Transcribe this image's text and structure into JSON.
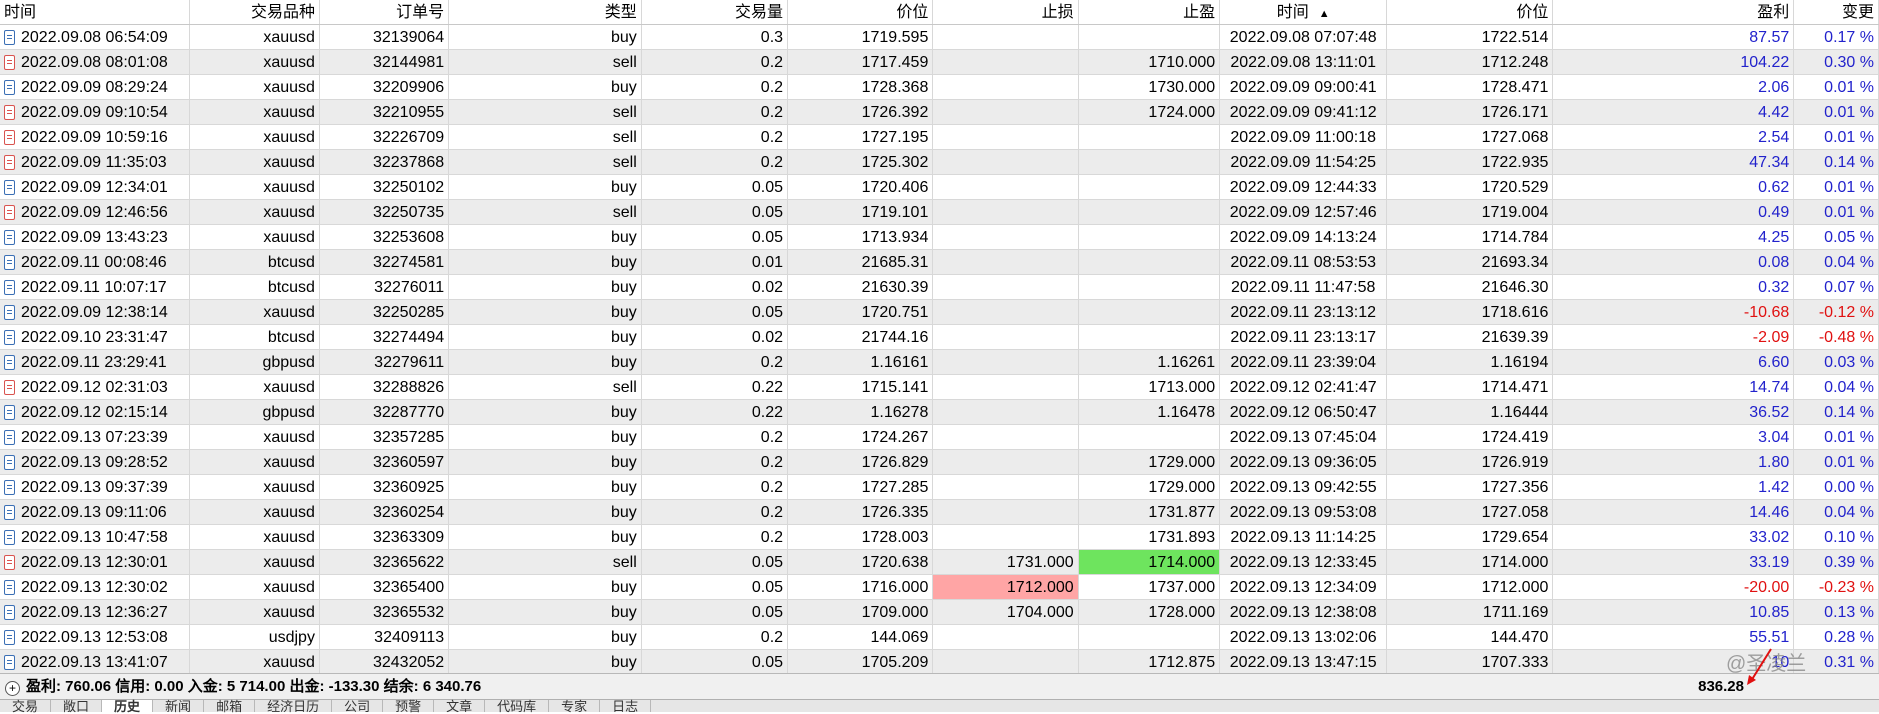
{
  "columns": [
    "时间",
    "交易品种",
    "订单号",
    "类型",
    "交易量",
    "价位",
    "止损",
    "止盈",
    "时间",
    "价位",
    "盈利",
    "变更"
  ],
  "rows": [
    {
      "open_time": "2022.09.08 06:54:09",
      "symbol": "xauusd",
      "ticket": "32139064",
      "type": "buy",
      "volume": "0.3",
      "open_price": "1719.595",
      "sl": "",
      "tp": "",
      "close_time": "2022.09.08 07:07:48",
      "close_price": "1722.514",
      "profit": "87.57",
      "change": "0.17 %"
    },
    {
      "open_time": "2022.09.08 08:01:08",
      "symbol": "xauusd",
      "ticket": "32144981",
      "type": "sell",
      "volume": "0.2",
      "open_price": "1717.459",
      "sl": "",
      "tp": "1710.000",
      "close_time": "2022.09.08 13:11:01",
      "close_price": "1712.248",
      "profit": "104.22",
      "change": "0.30 %"
    },
    {
      "open_time": "2022.09.09 08:29:24",
      "symbol": "xauusd",
      "ticket": "32209906",
      "type": "buy",
      "volume": "0.2",
      "open_price": "1728.368",
      "sl": "",
      "tp": "1730.000",
      "close_time": "2022.09.09 09:00:41",
      "close_price": "1728.471",
      "profit": "2.06",
      "change": "0.01 %"
    },
    {
      "open_time": "2022.09.09 09:10:54",
      "symbol": "xauusd",
      "ticket": "32210955",
      "type": "sell",
      "volume": "0.2",
      "open_price": "1726.392",
      "sl": "",
      "tp": "1724.000",
      "close_time": "2022.09.09 09:41:12",
      "close_price": "1726.171",
      "profit": "4.42",
      "change": "0.01 %"
    },
    {
      "open_time": "2022.09.09 10:59:16",
      "symbol": "xauusd",
      "ticket": "32226709",
      "type": "sell",
      "volume": "0.2",
      "open_price": "1727.195",
      "sl": "",
      "tp": "",
      "close_time": "2022.09.09 11:00:18",
      "close_price": "1727.068",
      "profit": "2.54",
      "change": "0.01 %"
    },
    {
      "open_time": "2022.09.09 11:35:03",
      "symbol": "xauusd",
      "ticket": "32237868",
      "type": "sell",
      "volume": "0.2",
      "open_price": "1725.302",
      "sl": "",
      "tp": "",
      "close_time": "2022.09.09 11:54:25",
      "close_price": "1722.935",
      "profit": "47.34",
      "change": "0.14 %"
    },
    {
      "open_time": "2022.09.09 12:34:01",
      "symbol": "xauusd",
      "ticket": "32250102",
      "type": "buy",
      "volume": "0.05",
      "open_price": "1720.406",
      "sl": "",
      "tp": "",
      "close_time": "2022.09.09 12:44:33",
      "close_price": "1720.529",
      "profit": "0.62",
      "change": "0.01 %"
    },
    {
      "open_time": "2022.09.09 12:46:56",
      "symbol": "xauusd",
      "ticket": "32250735",
      "type": "sell",
      "volume": "0.05",
      "open_price": "1719.101",
      "sl": "",
      "tp": "",
      "close_time": "2022.09.09 12:57:46",
      "close_price": "1719.004",
      "profit": "0.49",
      "change": "0.01 %"
    },
    {
      "open_time": "2022.09.09 13:43:23",
      "symbol": "xauusd",
      "ticket": "32253608",
      "type": "buy",
      "volume": "0.05",
      "open_price": "1713.934",
      "sl": "",
      "tp": "",
      "close_time": "2022.09.09 14:13:24",
      "close_price": "1714.784",
      "profit": "4.25",
      "change": "0.05 %"
    },
    {
      "open_time": "2022.09.11 00:08:46",
      "symbol": "btcusd",
      "ticket": "32274581",
      "type": "buy",
      "volume": "0.01",
      "open_price": "21685.31",
      "sl": "",
      "tp": "",
      "close_time": "2022.09.11 08:53:53",
      "close_price": "21693.34",
      "profit": "0.08",
      "change": "0.04 %"
    },
    {
      "open_time": "2022.09.11 10:07:17",
      "symbol": "btcusd",
      "ticket": "32276011",
      "type": "buy",
      "volume": "0.02",
      "open_price": "21630.39",
      "sl": "",
      "tp": "",
      "close_time": "2022.09.11 11:47:58",
      "close_price": "21646.30",
      "profit": "0.32",
      "change": "0.07 %"
    },
    {
      "open_time": "2022.09.09 12:38:14",
      "symbol": "xauusd",
      "ticket": "32250285",
      "type": "buy",
      "volume": "0.05",
      "open_price": "1720.751",
      "sl": "",
      "tp": "",
      "close_time": "2022.09.11 23:13:12",
      "close_price": "1718.616",
      "profit": "-10.68",
      "change": "-0.12 %"
    },
    {
      "open_time": "2022.09.10 23:31:47",
      "symbol": "btcusd",
      "ticket": "32274494",
      "type": "buy",
      "volume": "0.02",
      "open_price": "21744.16",
      "sl": "",
      "tp": "",
      "close_time": "2022.09.11 23:13:17",
      "close_price": "21639.39",
      "profit": "-2.09",
      "change": "-0.48 %"
    },
    {
      "open_time": "2022.09.11 23:29:41",
      "symbol": "gbpusd",
      "ticket": "32279611",
      "type": "buy",
      "volume": "0.2",
      "open_price": "1.16161",
      "sl": "",
      "tp": "1.16261",
      "close_time": "2022.09.11 23:39:04",
      "close_price": "1.16194",
      "profit": "6.60",
      "change": "0.03 %"
    },
    {
      "open_time": "2022.09.12 02:31:03",
      "symbol": "xauusd",
      "ticket": "32288826",
      "type": "sell",
      "volume": "0.22",
      "open_price": "1715.141",
      "sl": "",
      "tp": "1713.000",
      "close_time": "2022.09.12 02:41:47",
      "close_price": "1714.471",
      "profit": "14.74",
      "change": "0.04 %"
    },
    {
      "open_time": "2022.09.12 02:15:14",
      "symbol": "gbpusd",
      "ticket": "32287770",
      "type": "buy",
      "volume": "0.22",
      "open_price": "1.16278",
      "sl": "",
      "tp": "1.16478",
      "close_time": "2022.09.12 06:50:47",
      "close_price": "1.16444",
      "profit": "36.52",
      "change": "0.14 %"
    },
    {
      "open_time": "2022.09.13 07:23:39",
      "symbol": "xauusd",
      "ticket": "32357285",
      "type": "buy",
      "volume": "0.2",
      "open_price": "1724.267",
      "sl": "",
      "tp": "",
      "close_time": "2022.09.13 07:45:04",
      "close_price": "1724.419",
      "profit": "3.04",
      "change": "0.01 %"
    },
    {
      "open_time": "2022.09.13 09:28:52",
      "symbol": "xauusd",
      "ticket": "32360597",
      "type": "buy",
      "volume": "0.2",
      "open_price": "1726.829",
      "sl": "",
      "tp": "1729.000",
      "close_time": "2022.09.13 09:36:05",
      "close_price": "1726.919",
      "profit": "1.80",
      "change": "0.01 %"
    },
    {
      "open_time": "2022.09.13 09:37:39",
      "symbol": "xauusd",
      "ticket": "32360925",
      "type": "buy",
      "volume": "0.2",
      "open_price": "1727.285",
      "sl": "",
      "tp": "1729.000",
      "close_time": "2022.09.13 09:42:55",
      "close_price": "1727.356",
      "profit": "1.42",
      "change": "0.00 %"
    },
    {
      "open_time": "2022.09.13 09:11:06",
      "symbol": "xauusd",
      "ticket": "32360254",
      "type": "buy",
      "volume": "0.2",
      "open_price": "1726.335",
      "sl": "",
      "tp": "1731.877",
      "close_time": "2022.09.13 09:53:08",
      "close_price": "1727.058",
      "profit": "14.46",
      "change": "0.04 %"
    },
    {
      "open_time": "2022.09.13 10:47:58",
      "symbol": "xauusd",
      "ticket": "32363309",
      "type": "buy",
      "volume": "0.2",
      "open_price": "1728.003",
      "sl": "",
      "tp": "1731.893",
      "close_time": "2022.09.13 11:14:25",
      "close_price": "1729.654",
      "profit": "33.02",
      "change": "0.10 %"
    },
    {
      "open_time": "2022.09.13 12:30:01",
      "symbol": "xauusd",
      "ticket": "32365622",
      "type": "sell",
      "volume": "0.05",
      "open_price": "1720.638",
      "sl": "1731.000",
      "tp": "1714.000",
      "close_time": "2022.09.13 12:33:45",
      "close_price": "1714.000",
      "profit": "33.19",
      "change": "0.39 %",
      "tp_hl": "green"
    },
    {
      "open_time": "2022.09.13 12:30:02",
      "symbol": "xauusd",
      "ticket": "32365400",
      "type": "buy",
      "volume": "0.05",
      "open_price": "1716.000",
      "sl": "1712.000",
      "tp": "1737.000",
      "close_time": "2022.09.13 12:34:09",
      "close_price": "1712.000",
      "profit": "-20.00",
      "change": "-0.23 %",
      "sl_hl": "red"
    },
    {
      "open_time": "2022.09.13 12:36:27",
      "symbol": "xauusd",
      "ticket": "32365532",
      "type": "buy",
      "volume": "0.05",
      "open_price": "1709.000",
      "sl": "1704.000",
      "tp": "1728.000",
      "close_time": "2022.09.13 12:38:08",
      "close_price": "1711.169",
      "profit": "10.85",
      "change": "0.13 %"
    },
    {
      "open_time": "2022.09.13 12:53:08",
      "symbol": "usdjpy",
      "ticket": "32409113",
      "type": "buy",
      "volume": "0.2",
      "open_price": "144.069",
      "sl": "",
      "tp": "",
      "close_time": "2022.09.13 13:02:06",
      "close_price": "144.470",
      "profit": "55.51",
      "change": "0.28 %"
    },
    {
      "open_time": "2022.09.13 13:41:07",
      "symbol": "xauusd",
      "ticket": "32432052",
      "type": "buy",
      "volume": "0.05",
      "open_price": "1705.209",
      "sl": "",
      "tp": "1712.875",
      "close_time": "2022.09.13 13:47:15",
      "close_price": "1707.333",
      "profit": "10",
      "change": "0.31 %"
    }
  ],
  "summary": {
    "text": "盈利: 760.06  信用: 0.00  入金: 5 714.00  出金: -133.30  结余: 6 340.76",
    "total": "836.28"
  },
  "watermark": "@圣凌兰",
  "tabs": [
    "交易",
    "敞口",
    "历史",
    "新闻",
    "邮箱",
    "经济日历",
    "公司",
    "预警",
    "文章",
    "代码库",
    "专家",
    "日志"
  ],
  "active_tab": 2,
  "colors": {
    "positive": "#2222cc",
    "negative": "#e01010",
    "sl_hit": "#ffa5a5",
    "tp_hit": "#6ee45e"
  }
}
